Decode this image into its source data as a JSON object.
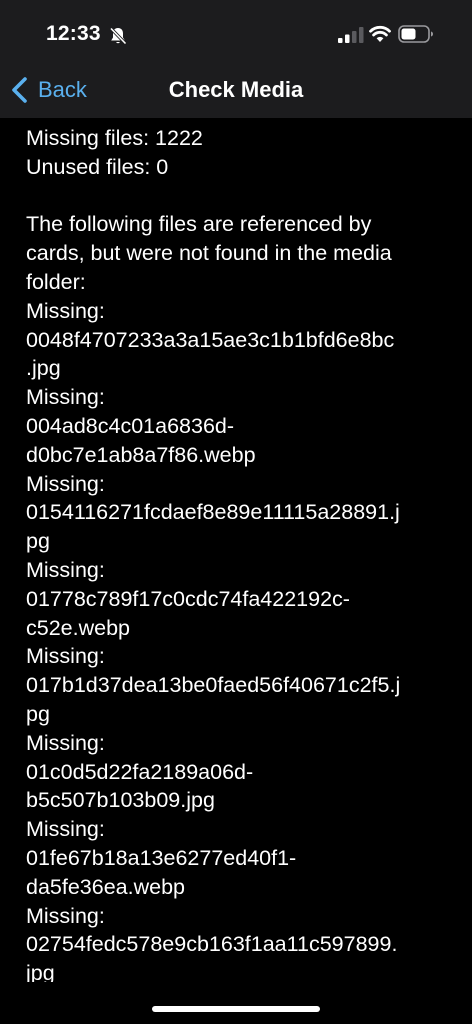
{
  "status_bar": {
    "time": "12:33",
    "icons": [
      "bell-slash-icon",
      "cellular-signal-icon",
      "wifi-icon",
      "battery-icon"
    ]
  },
  "nav": {
    "back_label": "Back",
    "title": "Check Media"
  },
  "content": {
    "missing_summary": "Missing files: 1222",
    "unused_summary": "Unused files: 0",
    "description_lines": [
      "The following files are referenced by",
      "cards, but were not found in the media",
      "folder:"
    ],
    "missing_entries": [
      {
        "label": "Missing:",
        "lines": [
          "0048f4707233a3a15ae3c1b1bfd6e8bc",
          ".jpg"
        ]
      },
      {
        "label": "Missing:",
        "lines": [
          "004ad8c4c01a6836d-",
          "d0bc7e1ab8a7f86.webp"
        ]
      },
      {
        "label": "Missing:",
        "lines": [
          "0154116271fcdaef8e89e11115a28891.j",
          "pg"
        ]
      },
      {
        "label": "Missing:",
        "lines": [
          "01778c789f17c0cdc74fa422192c-",
          "c52e.webp"
        ]
      },
      {
        "label": "Missing:",
        "lines": [
          "017b1d37dea13be0faed56f40671c2f5.j",
          "pg"
        ]
      },
      {
        "label": "Missing:",
        "lines": [
          "01c0d5d22fa2189a06d-",
          "b5c507b103b09.jpg"
        ]
      },
      {
        "label": "Missing:",
        "lines": [
          "01fe67b18a13e6277ed40f1-",
          "da5fe36ea.webp"
        ]
      },
      {
        "label": "Missing:",
        "lines": [
          "02754fedc578e9cb163f1aa11c597899.",
          "jpg"
        ]
      }
    ]
  },
  "colors": {
    "background": "#000000",
    "bar_background": "#1c1c1e",
    "accent": "#5ab0ee",
    "text": "#ffffff"
  }
}
